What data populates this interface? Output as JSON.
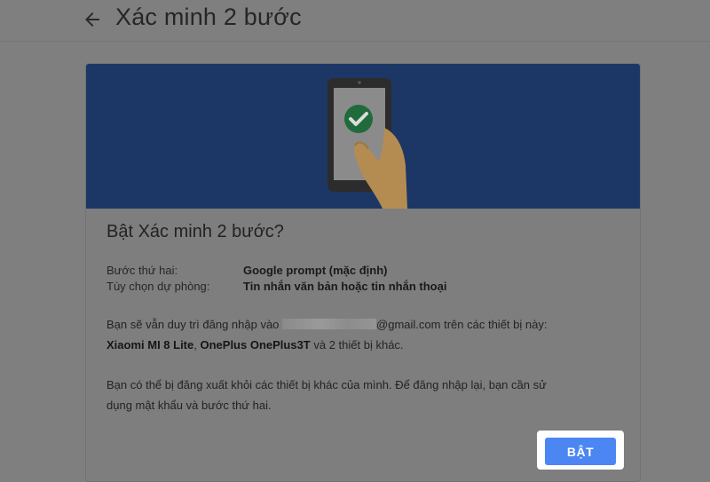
{
  "header": {
    "back_icon": "arrow-left-icon",
    "title": "Xác minh 2 bước"
  },
  "card": {
    "banner_icon": "phone-checkmark-illustration",
    "heading": "Bật Xác minh 2 bước?",
    "rows": [
      {
        "label": "Bước thứ hai:",
        "value": "Google prompt (mặc định)"
      },
      {
        "label": "Tùy chọn dự phòng:",
        "value": "Tin nhắn văn bản hoặc tin nhắn thoại"
      }
    ],
    "signed_in": {
      "prefix": "Bạn sẽ vẫn duy trì đăng nhập vào",
      "email_suffix": "@gmail.com",
      "middle": "trên các thiết bị này:",
      "device1": "Xiaomi MI 8 Lite",
      "device2": "OnePlus OnePlus3T",
      "suffix": "và 2 thiết bị khác."
    },
    "warning_line1": "Bạn có thể bị đăng xuất khỏi các thiết bị khác của mình. Để đăng nhập lại, bạn cần sử",
    "warning_line2": "dụng mật khẩu và bước thứ hai.",
    "button_label": "BẬT"
  },
  "colors": {
    "banner": "#1c3765",
    "button": "#4c86f2",
    "overlay": "#7f7f7f"
  }
}
